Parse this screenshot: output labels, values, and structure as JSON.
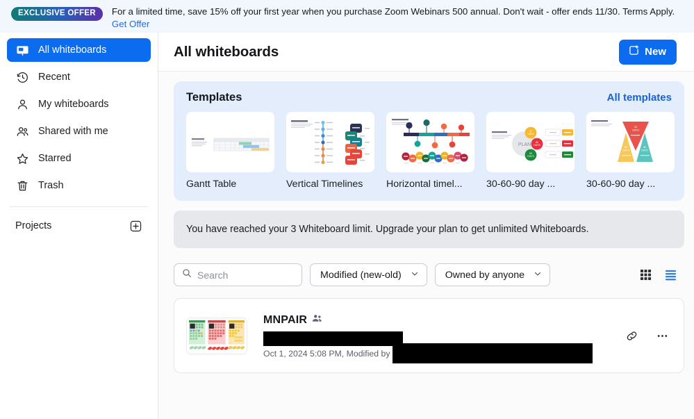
{
  "promo": {
    "badge": "EXCLUSIVE OFFER",
    "text": "For a limited time, save 15% off your first year when you purchase Zoom Webinars 500 annual. Don't wait - offer ends 11/30. Terms Apply. ",
    "link_label": "Get Offer"
  },
  "sidebar": {
    "items": [
      {
        "label": "All whiteboards",
        "icon": "whiteboard-icon",
        "active": true
      },
      {
        "label": "Recent",
        "icon": "clock-icon",
        "active": false
      },
      {
        "label": "My whiteboards",
        "icon": "person-icon",
        "active": false
      },
      {
        "label": "Shared with me",
        "icon": "people-icon",
        "active": false
      },
      {
        "label": "Starred",
        "icon": "star-icon",
        "active": false
      },
      {
        "label": "Trash",
        "icon": "trash-icon",
        "active": false
      }
    ],
    "projects_label": "Projects",
    "add_project_icon": "plus-square-icon"
  },
  "header": {
    "title": "All whiteboards",
    "new_button": "New",
    "new_button_icon": "new-board-plus-icon"
  },
  "templates": {
    "title": "Templates",
    "all_link": "All templates",
    "cards": [
      {
        "label": "Gantt Table",
        "thumb": "gantt-table-thumb"
      },
      {
        "label": "Vertical Timelines",
        "thumb": "vertical-timeline-thumb"
      },
      {
        "label": "Horizontal timel...",
        "thumb": "horizontal-timeline-thumb"
      },
      {
        "label": "30-60-90 day ...",
        "thumb": "plan-circle-thumb"
      },
      {
        "label": "30-60-90 day ...",
        "thumb": "triangles-thumb"
      }
    ]
  },
  "limit_notice": {
    "text": "You have reached your 3 Whiteboard limit. Upgrade your plan to get unlimited Whiteboards."
  },
  "filters": {
    "search_placeholder": "Search",
    "search_value": "",
    "search_icon": "search-icon",
    "sort_select": "Modified (new-old)",
    "owner_select": "Owned by anyone",
    "grid_view_icon": "grid-view-icon",
    "list_view_icon": "list-view-icon",
    "active_view": "list"
  },
  "boards": [
    {
      "title": "MNPAIR",
      "shared_icon": "shared-people-icon",
      "meta": "Oct 1, 2024 5:08 PM, Modified by",
      "thumb": "sticky-notes-thumb",
      "link_icon": "link-icon",
      "more_icon": "more-options-icon"
    }
  ],
  "colors": {
    "accent_blue": "#0b6cf0",
    "link_blue": "#1b63cf",
    "panel_blue": "#e3edfb",
    "banner_bg": "#f2f7fe",
    "notice_gray": "#e7e8ec"
  }
}
